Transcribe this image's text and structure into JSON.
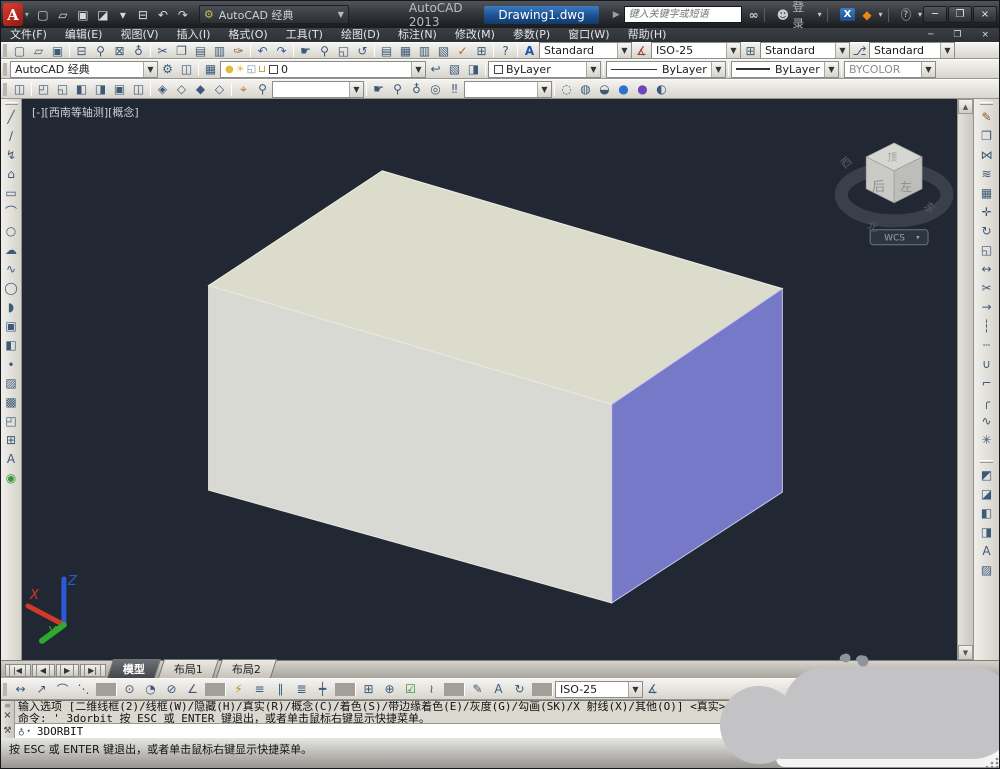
{
  "titlebar": {
    "logo_letter": "A",
    "qat": [
      {
        "name": "qat-new-button",
        "glyph": "▢"
      },
      {
        "name": "qat-open-button",
        "glyph": "▱"
      },
      {
        "name": "qat-save-button",
        "glyph": "▣"
      },
      {
        "name": "qat-saveas-button",
        "glyph": "◪"
      },
      {
        "name": "qat-more-dropdown",
        "glyph": "▾"
      },
      {
        "name": "qat-plot-button",
        "glyph": "⊟"
      },
      {
        "name": "qat-undo-button",
        "glyph": "↶"
      },
      {
        "name": "qat-redo-button",
        "glyph": "↷"
      }
    ],
    "workspace_value": "AutoCAD 经典",
    "app_title": "AutoCAD 2013",
    "doc_title": "Drawing1.dwg",
    "search_placeholder": "键入关键字或短语",
    "signin_label": "登录",
    "exchange_label": "X",
    "window_buttons": [
      {
        "name": "minimize-button",
        "glyph": "─"
      },
      {
        "name": "maximize-button",
        "glyph": "❐"
      },
      {
        "name": "close-button",
        "glyph": "×"
      }
    ]
  },
  "menubar": {
    "items": [
      {
        "name": "menu-file",
        "label": "文件(F)"
      },
      {
        "name": "menu-edit",
        "label": "编辑(E)"
      },
      {
        "name": "menu-view",
        "label": "视图(V)"
      },
      {
        "name": "menu-insert",
        "label": "插入(I)"
      },
      {
        "name": "menu-format",
        "label": "格式(O)"
      },
      {
        "name": "menu-tools",
        "label": "工具(T)"
      },
      {
        "name": "menu-draw",
        "label": "绘图(D)"
      },
      {
        "name": "menu-dimension",
        "label": "标注(N)"
      },
      {
        "name": "menu-modify",
        "label": "修改(M)"
      },
      {
        "name": "menu-parametric",
        "label": "参数(P)"
      },
      {
        "name": "menu-window",
        "label": "窗口(W)"
      },
      {
        "name": "menu-help",
        "label": "帮助(H)"
      }
    ],
    "controls": [
      {
        "name": "doc-minimize-button",
        "glyph": "─"
      },
      {
        "name": "doc-restore-button",
        "glyph": "❐"
      },
      {
        "name": "doc-close-button",
        "glyph": "×"
      }
    ]
  },
  "standard_toolbar": {
    "items": [
      {
        "name": "new-button",
        "glyph": "▢"
      },
      {
        "name": "open-button",
        "glyph": "▱"
      },
      {
        "name": "save-button",
        "glyph": "▣"
      },
      {
        "sep": true
      },
      {
        "name": "plot-button",
        "glyph": "⊟"
      },
      {
        "name": "plot-preview-button",
        "glyph": "⚲"
      },
      {
        "name": "publish-button",
        "glyph": "⊠"
      },
      {
        "name": "upload-button",
        "glyph": "♁"
      },
      {
        "sep": true
      },
      {
        "name": "cut-button",
        "glyph": "✂"
      },
      {
        "name": "copy-button",
        "glyph": "❐"
      },
      {
        "name": "paste-button",
        "glyph": "▤"
      },
      {
        "name": "paste-special-button",
        "glyph": "▥"
      },
      {
        "name": "match-properties-button",
        "glyph": "✑",
        "color": "#8a5a2a"
      },
      {
        "sep": true
      },
      {
        "name": "undo-button",
        "glyph": "↶",
        "color": "#2e5f9e"
      },
      {
        "name": "redo-button",
        "glyph": "↷",
        "color": "#2e5f9e"
      },
      {
        "sep": true
      },
      {
        "name": "pan-button",
        "glyph": "☛"
      },
      {
        "name": "zoom-realtime-button",
        "glyph": "⚲"
      },
      {
        "name": "zoom-window-button",
        "glyph": "◱"
      },
      {
        "name": "zoom-previous-button",
        "glyph": "↺"
      },
      {
        "sep": true
      },
      {
        "name": "properties-button",
        "glyph": "▤"
      },
      {
        "name": "designcenter-button",
        "glyph": "▦"
      },
      {
        "name": "tool-palettes-button",
        "glyph": "▥"
      },
      {
        "name": "sheetset-manager-button",
        "glyph": "▧"
      },
      {
        "name": "markup-button",
        "glyph": "✓",
        "color": "#b06820"
      },
      {
        "name": "quickcalc-button",
        "glyph": "⊞"
      },
      {
        "sep": true
      },
      {
        "name": "help-button",
        "glyph": "?"
      }
    ],
    "text_style_icon": "A",
    "text_style": "Standard",
    "dim_style": "ISO-25",
    "table_style": "Standard",
    "mleader_style": "Standard"
  },
  "properties_row": {
    "workspace_value": "AutoCAD 经典",
    "gear_glyph": "⚙",
    "my_workspace_glyph": "◫",
    "layer_manager_glyph": "▦",
    "layer_icons": [
      {
        "name": "layer-on-icon",
        "glyph": "●",
        "color": "#e0bb3e"
      },
      {
        "name": "layer-freeze-icon",
        "glyph": "☀",
        "color": "#e0bb3e"
      },
      {
        "name": "layer-vp-freeze-icon",
        "glyph": "◱",
        "color": "#7a8ba8"
      },
      {
        "name": "layer-lock-icon",
        "glyph": "⊔",
        "color": "#c09a38"
      }
    ],
    "layer_value": "0",
    "layer_tools": [
      {
        "name": "layer-previous-button",
        "glyph": "↩"
      },
      {
        "name": "layer-states-button",
        "glyph": "▧"
      },
      {
        "name": "layer-isolate-button",
        "glyph": "◨"
      }
    ],
    "color_value": "ByLayer",
    "linetype_value": "ByLayer",
    "lineweight_value": "ByLayer",
    "plot_style_value": "BYCOLOR"
  },
  "view_row": {
    "items_left": [
      {
        "name": "named-views-button",
        "glyph": "◫"
      },
      {
        "sep": true
      },
      {
        "name": "view-top-button",
        "glyph": "◰"
      },
      {
        "name": "view-bottom-button",
        "glyph": "◱"
      },
      {
        "name": "view-left-button",
        "glyph": "◧"
      },
      {
        "name": "view-right-button",
        "glyph": "◨"
      },
      {
        "name": "view-front-button",
        "glyph": "▣"
      },
      {
        "name": "view-back-button",
        "glyph": "◫"
      },
      {
        "sep": true
      },
      {
        "name": "view-sw-isometric-button",
        "glyph": "◈"
      },
      {
        "name": "view-se-isometric-button",
        "glyph": "◇"
      },
      {
        "name": "view-ne-isometric-button",
        "glyph": "◆"
      },
      {
        "name": "view-nw-isometric-button",
        "glyph": "◇"
      },
      {
        "sep": true
      },
      {
        "name": "camera-button",
        "glyph": "⌖",
        "color": "#b06820"
      },
      {
        "name": "zoom-named-button",
        "glyph": "⚲"
      }
    ],
    "named_view_value": "",
    "nav_items": [
      {
        "name": "pan-button",
        "glyph": "☛"
      },
      {
        "name": "zoom-button",
        "glyph": "⚲"
      },
      {
        "name": "orbit-button",
        "glyph": "♁"
      },
      {
        "name": "steering-wheel-button",
        "glyph": "◎"
      },
      {
        "name": "walk-button",
        "glyph": "‼"
      }
    ],
    "visual_style_value": "",
    "vs_items": [
      {
        "name": "vs-2d-wireframe-button",
        "glyph": "◌"
      },
      {
        "name": "vs-wireframe-button",
        "glyph": "◍"
      },
      {
        "name": "vs-hidden-button",
        "glyph": "◒"
      },
      {
        "name": "vs-realistic-button",
        "glyph": "●",
        "color": "#2f6fd0"
      },
      {
        "name": "vs-conceptual-button",
        "glyph": "●",
        "color": "#6d46b8"
      },
      {
        "name": "vs-manager-button",
        "glyph": "◐"
      }
    ]
  },
  "draw_toolbar": {
    "items": [
      {
        "name": "line-button",
        "glyph": "╱"
      },
      {
        "name": "construction-line-button",
        "glyph": "∕"
      },
      {
        "name": "polyline-button",
        "glyph": "↯"
      },
      {
        "name": "polygon-button",
        "glyph": "⌂"
      },
      {
        "name": "rectangle-button",
        "glyph": "▭"
      },
      {
        "name": "arc-button",
        "glyph": "⌒"
      },
      {
        "name": "circle-button",
        "glyph": "○"
      },
      {
        "name": "revision-cloud-button",
        "glyph": "☁"
      },
      {
        "name": "spline-button",
        "glyph": "∿"
      },
      {
        "name": "ellipse-button",
        "glyph": "◯"
      },
      {
        "name": "ellipse-arc-button",
        "glyph": "◗"
      },
      {
        "name": "insert-block-button",
        "glyph": "▣"
      },
      {
        "name": "create-block-button",
        "glyph": "◧"
      },
      {
        "name": "point-button",
        "glyph": "∙"
      },
      {
        "name": "hatch-button",
        "glyph": "▨"
      },
      {
        "name": "gradient-button",
        "glyph": "▩"
      },
      {
        "name": "region-button",
        "glyph": "◰"
      },
      {
        "name": "table-button",
        "glyph": "⊞"
      },
      {
        "name": "multiline-text-button",
        "glyph": "A"
      },
      {
        "name": "draw-extra-button",
        "glyph": "◉",
        "color": "#3a9a3a"
      }
    ]
  },
  "modify_toolbar": {
    "items": [
      {
        "name": "erase-button",
        "glyph": "✎",
        "color": "#8a5a2a"
      },
      {
        "name": "copy-button",
        "glyph": "❐"
      },
      {
        "name": "mirror-button",
        "glyph": "⋈"
      },
      {
        "name": "offset-button",
        "glyph": "≋"
      },
      {
        "name": "array-button",
        "glyph": "▦"
      },
      {
        "name": "move-button",
        "glyph": "✛"
      },
      {
        "name": "rotate-button",
        "glyph": "↻"
      },
      {
        "name": "scale-button",
        "glyph": "◱"
      },
      {
        "name": "stretch-button",
        "glyph": "↔"
      },
      {
        "name": "trim-button",
        "glyph": "✂"
      },
      {
        "name": "extend-button",
        "glyph": "→"
      },
      {
        "name": "break-at-point-button",
        "glyph": "┆"
      },
      {
        "name": "break-button",
        "glyph": "┄"
      },
      {
        "name": "join-button",
        "glyph": "∪"
      },
      {
        "name": "chamfer-button",
        "glyph": "⌐"
      },
      {
        "name": "fillet-button",
        "glyph": "╭"
      },
      {
        "name": "blend-curves-button",
        "glyph": "∿"
      },
      {
        "name": "explode-button",
        "glyph": "✳"
      }
    ]
  },
  "draworder_toolbar": {
    "items": [
      {
        "name": "bring-to-front-button",
        "glyph": "◩"
      },
      {
        "name": "send-to-back-button",
        "glyph": "◪"
      },
      {
        "name": "bring-above-button",
        "glyph": "◧"
      },
      {
        "name": "send-under-button",
        "glyph": "◨"
      },
      {
        "name": "text-to-front-button",
        "glyph": "A"
      },
      {
        "name": "hatch-to-back-button",
        "glyph": "▨"
      }
    ]
  },
  "viewport": {
    "label": "[-][西南等轴测][概念]",
    "viewcube": {
      "top_face": "顶",
      "front_face": "后",
      "right_face": "左",
      "wcs_label": "WCS",
      "compass": [
        "西",
        "北",
        "东"
      ]
    },
    "ucs": {
      "x": "X",
      "y": "Y",
      "z": "Z"
    }
  },
  "tabs": {
    "nav": [
      "|◀",
      "◀",
      "▶",
      "▶|"
    ],
    "items": [
      {
        "name": "tab-model",
        "label": "模型",
        "active": true
      },
      {
        "name": "tab-layout1",
        "label": "布局1"
      },
      {
        "name": "tab-layout2",
        "label": "布局2"
      }
    ]
  },
  "dim_toolbar": {
    "items": [
      {
        "name": "dim-linear-button",
        "glyph": "↔"
      },
      {
        "name": "dim-aligned-button",
        "glyph": "↗"
      },
      {
        "name": "dim-arc-length-button",
        "glyph": "⌒"
      },
      {
        "name": "dim-ordinate-button",
        "glyph": "⋱"
      },
      {
        "sep": true
      },
      {
        "name": "dim-radius-button",
        "glyph": "⊙"
      },
      {
        "name": "dim-jogged-button",
        "glyph": "◔"
      },
      {
        "name": "dim-diameter-button",
        "glyph": "⊘"
      },
      {
        "name": "dim-angular-button",
        "glyph": "∠"
      },
      {
        "sep": true
      },
      {
        "name": "dim-quick-button",
        "glyph": "⚡",
        "color": "#c09020"
      },
      {
        "name": "dim-baseline-button",
        "glyph": "≡"
      },
      {
        "name": "dim-continue-button",
        "glyph": "∥"
      },
      {
        "name": "dim-spacing-button",
        "glyph": "≣"
      },
      {
        "name": "dim-break-button",
        "glyph": "┿"
      },
      {
        "sep": true
      },
      {
        "name": "dim-tolerance-button",
        "glyph": "⊞"
      },
      {
        "name": "dim-center-mark-button",
        "glyph": "⊕"
      },
      {
        "name": "dim-inspect-button",
        "glyph": "☑",
        "color": "#2e8b2e"
      },
      {
        "name": "dim-jog-line-button",
        "glyph": "≀"
      },
      {
        "sep": true
      },
      {
        "name": "dim-edit-button",
        "glyph": "✎"
      },
      {
        "name": "dim-text-edit-button",
        "glyph": "A"
      },
      {
        "name": "dim-update-button",
        "glyph": "↻"
      },
      {
        "sep": true
      }
    ],
    "dim_style_value": "ISO-25",
    "dim_style_glyph": "∡"
  },
  "command": {
    "history": [
      "输入选项 [二维线框(2)/线框(W)/隐藏(H)/真实(R)/概念(C)/着色(S)/带边缘着色(E)/灰度(G)/勾画(SK)/X 射线(X)/其他(O)] <真实>: _C",
      "命令: '_3dorbit 按 ESC 或 ENTER 键退出，或者单击鼠标右键显示快捷菜单。"
    ],
    "input_value": "3DORBIT",
    "grip_glyph": "≡",
    "close_glyph": "×",
    "wrench_glyph": "⚒",
    "orbit_glyph": "♁"
  },
  "statusbar": {
    "message": "按 ESC 或 ENTER 键退出，或者单击鼠标右键显示快捷菜单。"
  },
  "colors": {
    "viewport_bg": "#212833",
    "box_top_face": "#dcdccd",
    "box_front_face": "#d9d9d3",
    "box_right_face": "#7678c8",
    "toolbar_bg": "#d5d2ca",
    "titlebar_bg": "#34383d",
    "doc_title_bg": "#1c5191",
    "blob": "#c3c3c5",
    "ucs_x": "#d03a2a",
    "ucs_y": "#2ea82e",
    "ucs_z": "#2b59d8"
  }
}
